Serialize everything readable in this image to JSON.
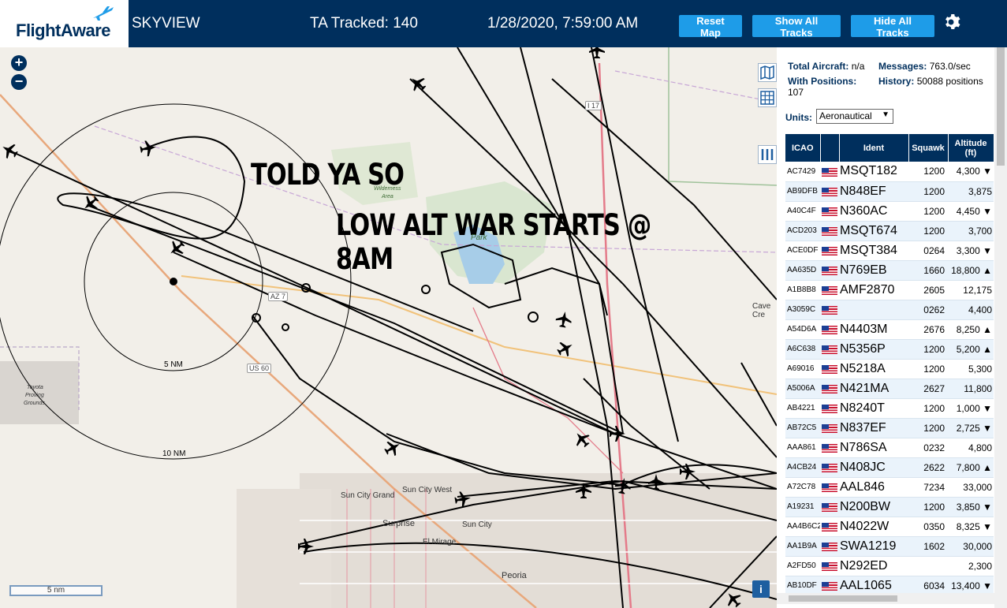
{
  "header": {
    "logo_text": "FlightAware",
    "app_name": "SKYVIEW",
    "tracked_label": "TA Tracked: 140",
    "clock": "1/28/2020, 7:59:00 AM",
    "reset_label": "Reset Map",
    "show_label": "Show All Tracks",
    "hide_label": "Hide All Tracks",
    "brand_color": "#002f5d",
    "button_color": "#1e9ce8"
  },
  "map": {
    "zoom_in": "+",
    "zoom_out": "−",
    "overlay_line1": "TOLD YA SO",
    "overlay_line2": "LOW ALT WAR STARTS @ 8AM",
    "scale_label": "5 nm",
    "info_label": "i",
    "range_5": "5 NM",
    "range_10": "10 NM",
    "place_labels": {
      "sun_city_grand": "Sun City Grand",
      "sun_city_west": "Sun City West",
      "sun_city": "Sun City",
      "surprise": "Surprise",
      "el_mirage": "El Mirage",
      "peoria": "Peoria",
      "cave_creek": "Cave Cre",
      "park": "Park",
      "wilderness": "Wilderness",
      "area": "Area",
      "toyota": "Toyota",
      "proving": "Proving",
      "grounds": "Grounds"
    },
    "road_labels": {
      "az": "AZ 7",
      "us60": "US 60",
      "i17": "I 17"
    },
    "icons": [
      "layers-icon",
      "grid-icon",
      "columns-icon",
      "info-icon",
      "gear-icon"
    ]
  },
  "panel": {
    "total_label": "Total Aircraft:",
    "total_value": "n/a",
    "msgs_label": "Messages:",
    "msgs_value": "763.0/sec",
    "pos_label": "With Positions:",
    "pos_value": "107",
    "hist_label": "History:",
    "hist_value": "50088 positions",
    "units_label": "Units:",
    "units_value": "Aeronautical",
    "columns": [
      "ICAO",
      "",
      "Ident",
      "Squawk",
      "Altitude (ft)"
    ],
    "rows": [
      {
        "icao": "AC7429",
        "ident": "MSQT182",
        "squawk": "1200",
        "alt": "4,300 ▼"
      },
      {
        "icao": "AB9DFB",
        "ident": "N848EF",
        "squawk": "1200",
        "alt": "3,875"
      },
      {
        "icao": "A40C4F",
        "ident": "N360AC",
        "squawk": "1200",
        "alt": "4,450 ▼"
      },
      {
        "icao": "ACD203",
        "ident": "MSQT674",
        "squawk": "1200",
        "alt": "3,700"
      },
      {
        "icao": "ACE0DF",
        "ident": "MSQT384",
        "squawk": "0264",
        "alt": "3,300 ▼"
      },
      {
        "icao": "AA635D",
        "ident": "N769EB",
        "squawk": "1660",
        "alt": "18,800 ▲"
      },
      {
        "icao": "A1B8B8",
        "ident": "AMF2870",
        "squawk": "2605",
        "alt": "12,175"
      },
      {
        "icao": "A3059C",
        "ident": "",
        "squawk": "0262",
        "alt": "4,400"
      },
      {
        "icao": "A54D6A",
        "ident": "N4403M",
        "squawk": "2676",
        "alt": "8,250 ▲"
      },
      {
        "icao": "A6C638",
        "ident": "N5356P",
        "squawk": "1200",
        "alt": "5,200 ▲"
      },
      {
        "icao": "A69016",
        "ident": "N5218A",
        "squawk": "1200",
        "alt": "5,300"
      },
      {
        "icao": "A5006A",
        "ident": "N421MA",
        "squawk": "2627",
        "alt": "11,800"
      },
      {
        "icao": "AB4221",
        "ident": "N8240T",
        "squawk": "1200",
        "alt": "1,000 ▼"
      },
      {
        "icao": "AB72C5",
        "ident": "N837EF",
        "squawk": "1200",
        "alt": "2,725 ▼"
      },
      {
        "icao": "AAA861",
        "ident": "N786SA",
        "squawk": "0232",
        "alt": "4,800"
      },
      {
        "icao": "A4CB24",
        "ident": "N408JC",
        "squawk": "2622",
        "alt": "7,800 ▲"
      },
      {
        "icao": "A72C78",
        "ident": "AAL846",
        "squawk": "7234",
        "alt": "33,000"
      },
      {
        "icao": "A19231",
        "ident": "N200BW",
        "squawk": "1200",
        "alt": "3,850 ▼"
      },
      {
        "icao": "AA4B6C2",
        "ident": "N4022W",
        "squawk": "0350",
        "alt": "8,325 ▼"
      },
      {
        "icao": "AA1B9A",
        "ident": "SWA1219",
        "squawk": "1602",
        "alt": "30,000"
      },
      {
        "icao": "A2FD50",
        "ident": "N292ED",
        "squawk": "",
        "alt": "2,300"
      },
      {
        "icao": "AB10DF",
        "ident": "AAL1065",
        "squawk": "6034",
        "alt": "13,400 ▼"
      }
    ]
  }
}
